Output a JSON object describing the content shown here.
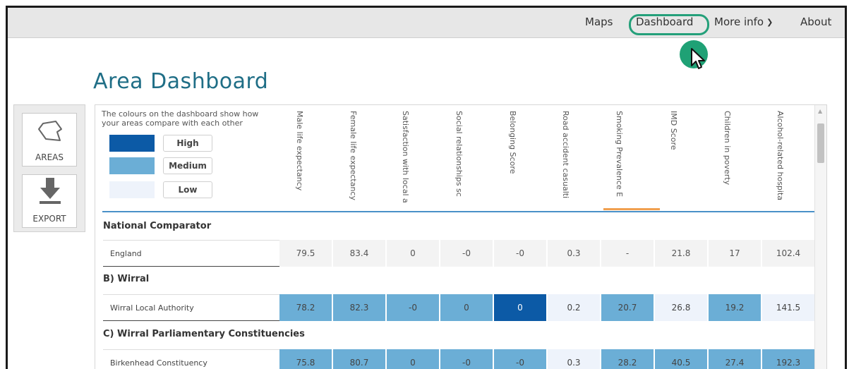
{
  "nav": {
    "maps": "Maps",
    "dashboard": "Dashboard",
    "more_info": "More info",
    "about": "About"
  },
  "title": "Area Dashboard",
  "side": {
    "areas": "AREAS",
    "export": "EXPORT"
  },
  "legend": {
    "text": "The colours on the dashboard show how your areas compare with each other",
    "high": "High",
    "medium": "Medium",
    "low": "Low",
    "colors": {
      "high": "#0c5aa6",
      "medium": "#6baed6",
      "low": "#eef3fb"
    }
  },
  "columns": [
    "Male life expectancy",
    "Female life expectancy",
    "Satisfaction with local a",
    "Social relationships sc",
    "Belonging Score",
    "Road accident casualti",
    "Smoking Prevalence E",
    "IMD Score",
    "Children in poverty",
    "Alcohol-related hospita"
  ],
  "sections": {
    "national": "National Comparator",
    "wirral": "B) Wirral",
    "constituencies": "C) Wirral Parliamentary Constituencies"
  },
  "rows": {
    "england": {
      "label": "England",
      "values": [
        "79.5",
        "83.4",
        "0",
        "-0",
        "-0",
        "0.3",
        "-",
        "21.8",
        "17",
        "102.4"
      ]
    },
    "wirral": {
      "label": "Wirral Local Authority",
      "values": [
        "78.2",
        "82.3",
        "-0",
        "0",
        "0",
        "0.2",
        "20.7",
        "26.8",
        "19.2",
        "141.5"
      ]
    },
    "birkenhead": {
      "label": "Birkenhead Constituency",
      "values": [
        "75.8",
        "80.7",
        "0",
        "-0",
        "-0",
        "0.3",
        "28.2",
        "40.5",
        "27.4",
        "192.3"
      ]
    }
  }
}
